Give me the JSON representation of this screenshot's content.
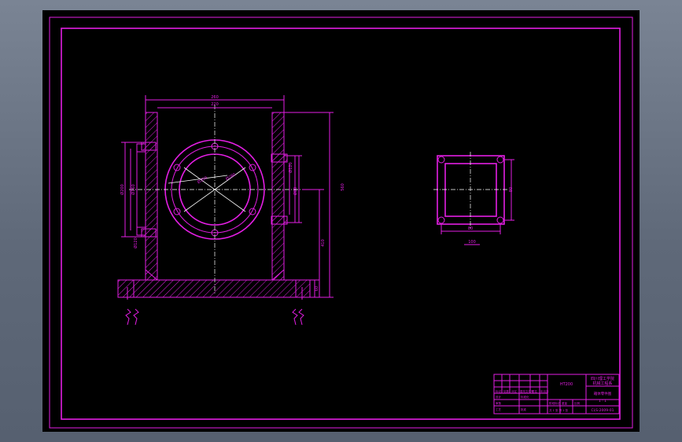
{
  "drawing": {
    "main_view": {
      "dim_top": "260",
      "dim_top_inner": "220",
      "dim_right_total": "560",
      "dim_right_lower": "410",
      "dim_right_base": "60",
      "dim_right_flange": "Ø120",
      "dim_right_bore": "Ø80",
      "dim_left_outer": "Ø200",
      "dim_left_inner": "Ø160",
      "dim_circle_pcd": "Ø350",
      "dim_circle_bore": "Ø280",
      "dim_left_bottom": "Ø120"
    },
    "side_view": {
      "dim_width": "80",
      "dim_height": "80",
      "dim_bottom": "100"
    },
    "title_block": {
      "title_line1": "四川理工学院",
      "title_line2": "机械工程系",
      "part_name": "箱体零件图",
      "scale_label": "1 : 1",
      "drawing_no": "CLS-2009-01",
      "material": "HT200",
      "row_labels": [
        "标记",
        "处数",
        "分区",
        "更改文件号",
        "签名",
        "年月日"
      ],
      "stage_label": "阶段标记",
      "weight_label": "重量",
      "ratio_label": "比例",
      "sheet_label": "共 1 张   第 1 张",
      "design_label": "设计",
      "std_label": "标准化",
      "review_label": "审核",
      "process_label": "工艺",
      "approve_label": "批准"
    }
  }
}
